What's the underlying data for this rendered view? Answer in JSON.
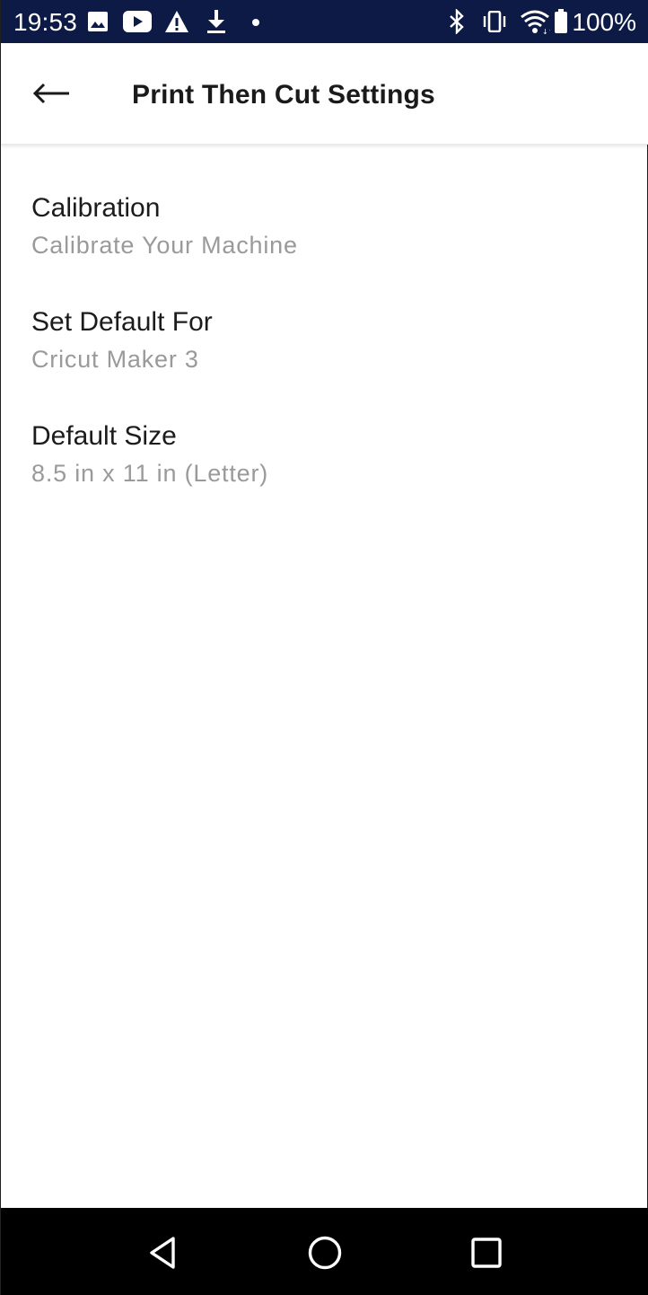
{
  "status_bar": {
    "time": "19:53",
    "battery_percent": "100%",
    "icons": [
      "image-icon",
      "youtube-icon",
      "warning-icon",
      "download-icon",
      "dot-icon",
      "bluetooth-icon",
      "vibrate-icon",
      "wifi-icon",
      "battery-icon"
    ],
    "background": "#0d1a45"
  },
  "app_bar": {
    "back_icon": "arrow-left-icon",
    "title": "Print Then Cut Settings"
  },
  "settings": [
    {
      "title": "Calibration",
      "subtitle": "Calibrate Your Machine"
    },
    {
      "title": "Set Default For",
      "subtitle": "Cricut Maker 3"
    },
    {
      "title": "Default Size",
      "subtitle": "8.5 in x 11 in (Letter)"
    }
  ],
  "nav_bar": {
    "buttons": [
      "back-triangle-icon",
      "home-circle-icon",
      "recents-square-icon"
    ]
  },
  "colors": {
    "title_text": "#1c1c1c",
    "subtitle_text": "#9a9a9a",
    "status_bar": "#0d1a45",
    "nav_bar": "#000000"
  }
}
